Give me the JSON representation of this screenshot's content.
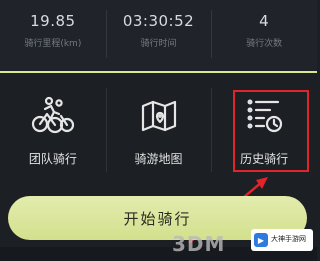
{
  "stats": [
    {
      "value": "19.85",
      "label": "骑行里程(km)"
    },
    {
      "value": "03:30:52",
      "label": "骑行时间"
    },
    {
      "value": "4",
      "label": "骑行次数"
    }
  ],
  "menu": [
    {
      "label": "团队骑行",
      "icon": "team-ride-icon"
    },
    {
      "label": "骑游地图",
      "icon": "ride-map-icon"
    },
    {
      "label": "历史骑行",
      "icon": "ride-history-icon"
    }
  ],
  "start_button": {
    "label": "开始骑行"
  },
  "watermark": {
    "text": "3DM"
  },
  "badge": {
    "text": "大神手游网"
  },
  "colors": {
    "accent": "#d9e98a",
    "highlight": "#e0242a",
    "background": "#1c1f24"
  }
}
